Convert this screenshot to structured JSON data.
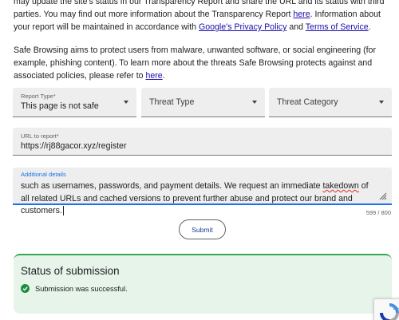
{
  "intro": {
    "p1_pre": "may update the site's status in our Transparency Report and share the URL and its status with third parties. You may find out more information about the Transparency Report ",
    "p1_link1": "here",
    "p1_mid": ". Information about your report will be maintained in accordance with ",
    "p1_link2": "Google's Privacy Policy",
    "p1_and": " and ",
    "p1_link3": "Terms of Service",
    "p1_end": ".",
    "p2_pre": "Safe Browsing aims to protect users from malware, unwanted software, or social engineering (for example, phishing content). To learn more about the threats Safe Browsing protects against and associated policies, please refer to ",
    "p2_link": "here",
    "p2_end": "."
  },
  "form": {
    "report_type": {
      "label": "Report Type*",
      "value": "This page is not safe"
    },
    "threat_type": {
      "label": "Threat Type"
    },
    "threat_category": {
      "label": "Threat Category"
    },
    "url": {
      "label": "URL to report*",
      "value": "https://rj88gacor.xyz/register"
    },
    "details": {
      "label": "Additional details",
      "text_pre": "such as usernames, passwords, and payment details. We request an immediate ",
      "text_flag": "takedown",
      "text_post": " of all related URLs and cached versions to prevent further abuse and protect our brand and customers."
    },
    "counter": "599 / 800",
    "submit_label": "Submit"
  },
  "status": {
    "title": "Status of submission",
    "message": "Submission was successful."
  },
  "icons": [
    "chevron-down-icon",
    "resize-handle-icon",
    "check-circle-icon",
    "recaptcha-icon"
  ],
  "colors": {
    "accent": "#1a73e8",
    "link": "#1a0dab",
    "success": "#34a853",
    "success_bg": "#e6f4ea",
    "error_underline": "#d93025"
  }
}
